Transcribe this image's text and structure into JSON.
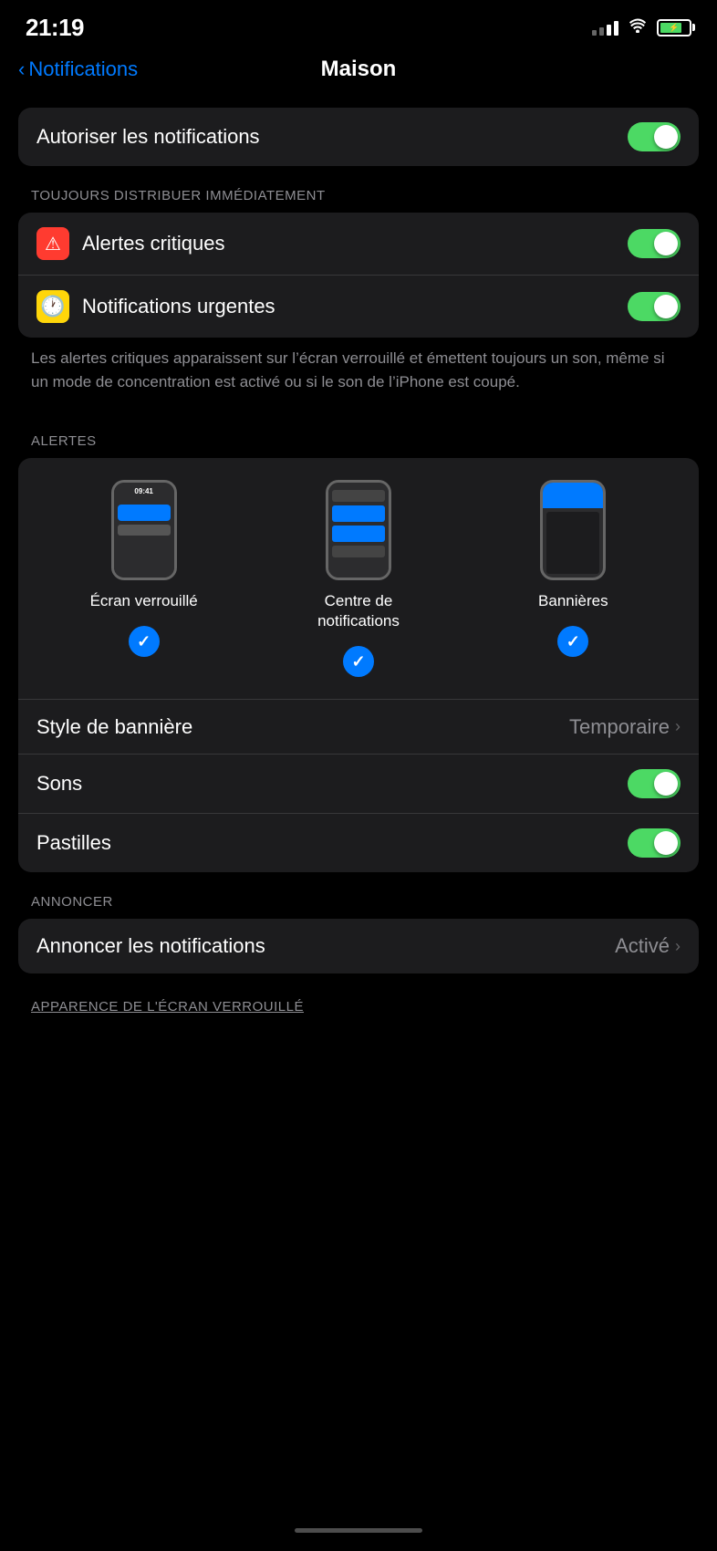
{
  "statusBar": {
    "time": "21:19",
    "timeIcon": "navigation-icon"
  },
  "nav": {
    "back": "Notifications",
    "title": "Maison"
  },
  "allowNotifications": {
    "label": "Autoriser les notifications",
    "enabled": true
  },
  "alwaysDeliverSection": {
    "label": "TOUJOURS DISTRIBUER IMMÉDIATEMENT",
    "criticalAlerts": {
      "label": "Alertes critiques",
      "enabled": true
    },
    "urgentNotifications": {
      "label": "Notifications urgentes",
      "enabled": true
    },
    "description": "Les alertes critiques apparaissent sur l’écran verrouillé et émettent toujours un son, même si un mode de concentration est activé ou si le son de l’iPhone est coupé."
  },
  "alertsSection": {
    "label": "ALERTES",
    "options": [
      {
        "label": "Écran verrouillé",
        "checked": true,
        "type": "lock-screen"
      },
      {
        "label": "Centre de notifications",
        "checked": true,
        "type": "notification-center"
      },
      {
        "label": "Bannières",
        "checked": true,
        "type": "banners"
      }
    ],
    "bannerStyle": {
      "label": "Style de bannière",
      "value": "Temporaire"
    },
    "sounds": {
      "label": "Sons",
      "enabled": true
    },
    "pastilles": {
      "label": "Pastilles",
      "enabled": true
    }
  },
  "announceSection": {
    "label": "ANNONCER",
    "announceNotifications": {
      "label": "Annoncer les notifications",
      "value": "Activé"
    }
  },
  "lockedScreenSection": {
    "label": "APPARENCE DE L'ÉCRAN VERROUILLÉ"
  },
  "phoneTime": "09:41"
}
